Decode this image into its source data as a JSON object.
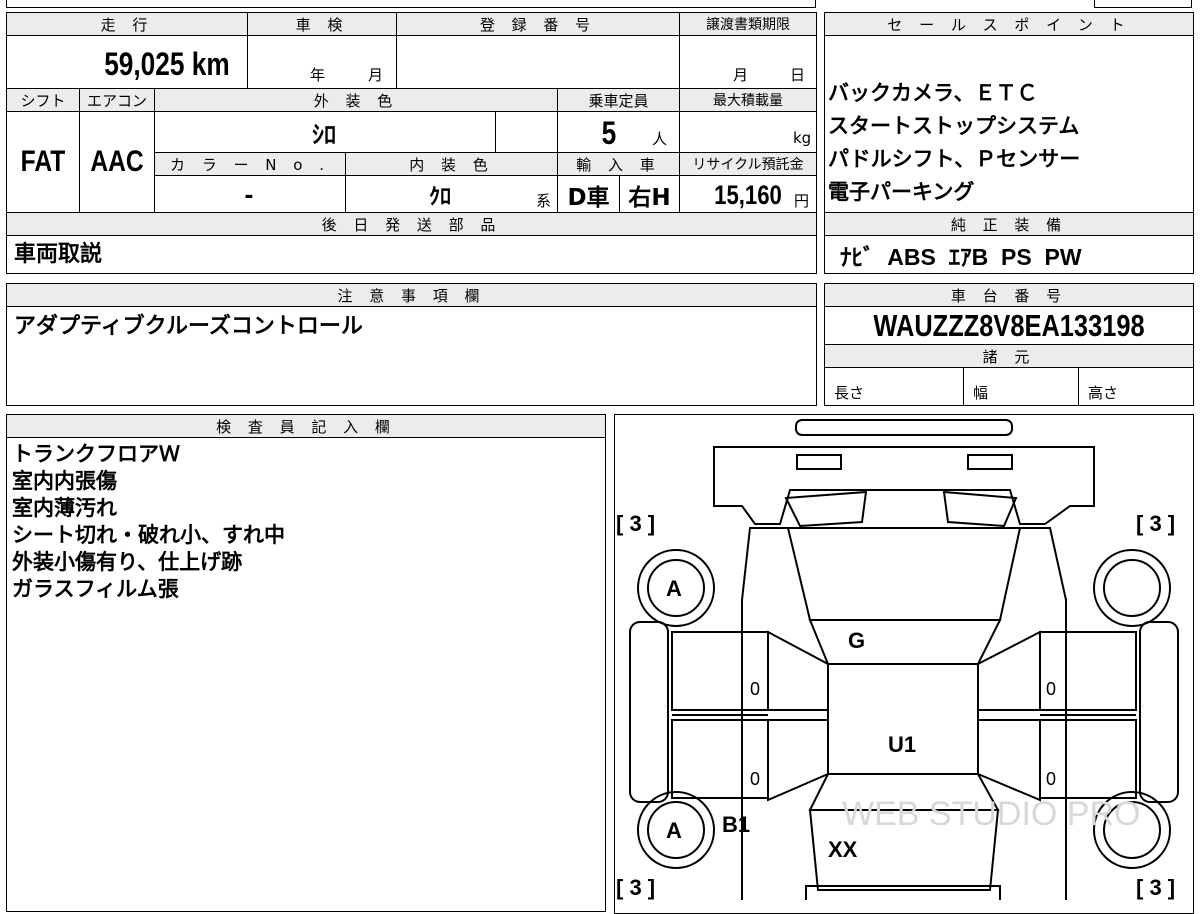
{
  "header": {
    "mileage_label": "走 行",
    "shaken_label": "車 検",
    "reg_no_label": "登 録 番 号",
    "transfer_deadline_label": "譲渡書類期限",
    "sales_points_label": "セ ー ル ス ポ イ ン ト"
  },
  "mileage": "59,025 km",
  "shaken": {
    "year_unit": "年",
    "month_unit": "月"
  },
  "registration_number": "",
  "transfer_deadline": {
    "month_unit": "月",
    "day_unit": "日"
  },
  "labels": {
    "shift": "シフト",
    "aircon": "エアコン",
    "exterior_color": "外 装 色",
    "capacity": "乗車定員",
    "max_load": "最大積載量",
    "color_no": "カ ラ ー N o .",
    "interior_color": "内 装 色",
    "import": "輸 入 車",
    "recycle": "リサイクル預託金",
    "later_parts": "後 日 発 送 部 品",
    "genuine_equipment": "純 正 装 備",
    "notes": "注 意 事 項 欄",
    "chassis_no": "車 台 番 号",
    "specs": "諸 元",
    "inspector": "検 査 員 記 入 欄"
  },
  "values": {
    "shift": "FAT",
    "aircon": "AAC",
    "exterior_color": "ｼﾛ",
    "capacity": "5",
    "capacity_unit": "人",
    "max_load_unit": "kg",
    "color_no": "-",
    "interior_color": "ｸﾛ",
    "interior_suffix": "系",
    "import_type": "D車",
    "steering": "右H",
    "recycle_fee": "15,160",
    "recycle_unit": "円",
    "later_parts": "車両取説",
    "genuine_equipment": "ﾅﾋﾞ  ABS  ｴｱB  PS  PW",
    "notes": "アダプティブクルーズコントロール",
    "chassis_no": "WAUZZZ8V8EA133198"
  },
  "sales_points": [
    "バックカメラ、ＥＴＣ",
    "スタートストップシステム",
    "パドルシフト、Ｐセンサー",
    "電子パーキング"
  ],
  "specs": {
    "length": "長さ",
    "width": "幅",
    "height": "高さ"
  },
  "inspector_notes": [
    "トランクフロアＷ",
    "室内内張傷",
    "室内薄汚れ",
    "シート切れ・破れ小、すれ中",
    "外装小傷有り、仕上げ跡",
    "ガラスフィルム張"
  ],
  "diagram": {
    "tire_brackets": [
      "[ 3 ]",
      "[ 3 ]",
      "[ 3 ]",
      "[ 3 ]"
    ],
    "marks": {
      "front_wheel": "A",
      "rear_wheel": "A",
      "hood": "G",
      "roof": "U1",
      "rear_door": "B1",
      "trunk": "XX"
    },
    "door_values": [
      "0",
      "0",
      "0",
      "0"
    ],
    "watermark": "WEB STUDIO PRO"
  }
}
